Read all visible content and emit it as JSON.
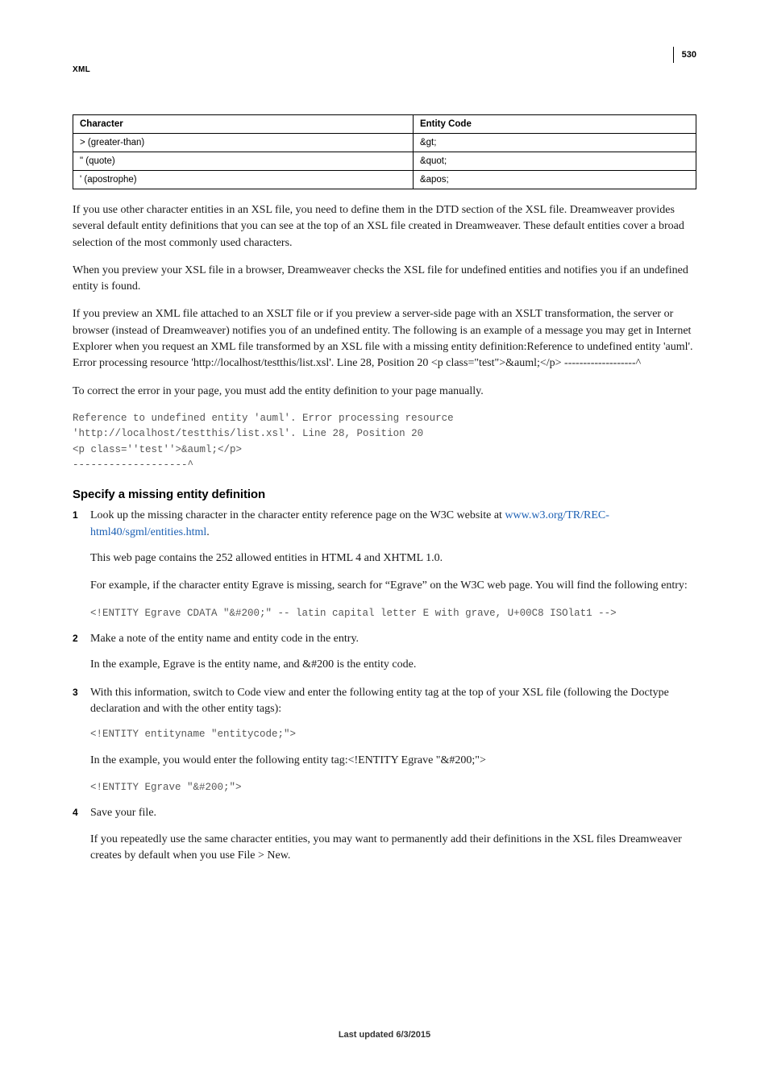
{
  "header": {
    "section_label": "XML",
    "page_number": "530"
  },
  "table": {
    "headers": {
      "col1": "Character",
      "col2": "Entity Code"
    },
    "rows": [
      {
        "char": "> (greater-than)",
        "code": "&gt;"
      },
      {
        "char": "\" (quote)",
        "code": "&quot;"
      },
      {
        "char": "' (apostrophe)",
        "code": "&apos;"
      }
    ]
  },
  "para1": "If you use other character entities in an XSL file, you need to define them in the DTD section of the XSL file. Dreamweaver provides several default entity definitions that you can see at the top of an XSL file created in Dreamweaver. These default entities cover a broad selection of the most commonly used characters.",
  "para2": "When you preview your XSL file in a browser, Dreamweaver checks the XSL file for undefined entities and notifies you if an undefined entity is found.",
  "para3": "If you preview an XML file attached to an XSLT file or if you preview a server-side page with an XSLT transformation, the server or browser (instead of Dreamweaver) notifies you of an undefined entity. The following is an example of a message you may get in Internet Explorer when you request an XML file transformed by an XSL file with a missing entity definition:Reference to undefined entity 'auml'. Error processing resource 'http://localhost/testthis/list.xsl'. Line 28, Position 20 <p class=\"test\">&auml;</p> -------------------^",
  "para4": "To correct the error in your page, you must add the entity definition to your page manually.",
  "code_block1": "Reference to undefined entity 'auml'. Error processing resource \n'http://localhost/testthis/list.xsl'. Line 28, Position 20  \n<p class=''test''>&auml;</p> \n-------------------^",
  "section_heading": "Specify a missing entity definition",
  "steps": {
    "s1": {
      "num": "1",
      "text_a": "Look up the missing character in the character entity reference page on the W3C website at ",
      "link_text": "www.w3.org/TR/REC-html40/sgml/entities.html",
      "text_b": ".",
      "p2": "This web page contains the 252 allowed entities in HTML 4 and XHTML 1.0.",
      "p3": "For example, if the character entity Egrave is missing, search for “Egrave” on the W3C web page. You will find the following entry:",
      "code": "<!ENTITY Egrave CDATA \"&#200;\" -- latin capital letter E with grave, U+00C8 ISOlat1 -->"
    },
    "s2": {
      "num": "2",
      "p1": "Make a note of the entity name and entity code in the entry.",
      "p2": "In the example, Egrave is the entity name, and &#200 is the entity code."
    },
    "s3": {
      "num": "3",
      "p1": "With this information, switch to Code view and enter the following entity tag at the top of your XSL file (following the Doctype declaration and with the other entity tags):",
      "code1": "<!ENTITY entityname \"entitycode;\">",
      "p2": "In the example, you would enter the following entity tag:<!ENTITY Egrave \"&#200;\">",
      "code2": "<!ENTITY Egrave \"&#200;\">"
    },
    "s4": {
      "num": "4",
      "p1": "Save your file.",
      "p2": "If you repeatedly use the same character entities, you may want to permanently add their definitions in the XSL files Dreamweaver creates by default when you use File > New."
    }
  },
  "footer": "Last updated 6/3/2015"
}
